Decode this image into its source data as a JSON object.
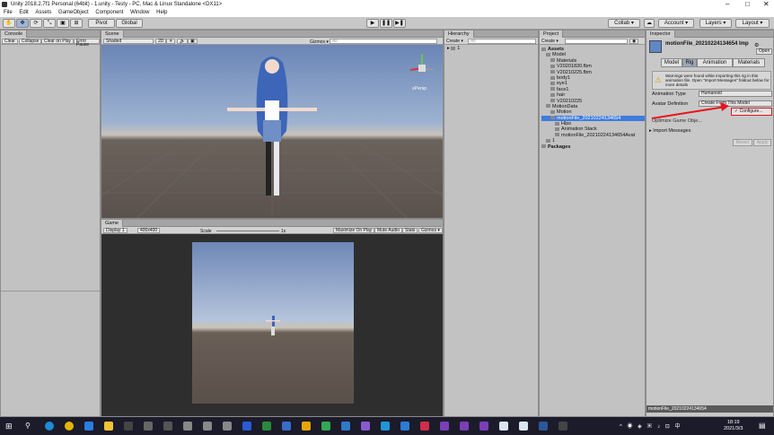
{
  "window": {
    "title": "Unity 2018.2.7f1 Personal (64bit) - 1.unity - Testy - PC, Mac & Linux Standalone <DX11>"
  },
  "menu": [
    "File",
    "Edit",
    "Assets",
    "GameObject",
    "Component",
    "Window",
    "Help"
  ],
  "toolbar": {
    "pivot": "Pivot",
    "global": "Global",
    "collab": "Collab ▾",
    "account": "Account ▾",
    "layers": "Layers ▾",
    "layout": "Layout ▾"
  },
  "console": {
    "tab": "Console",
    "buttons": [
      "Clear",
      "Collapse",
      "Clear on Play",
      "Error Pause"
    ]
  },
  "scene": {
    "tab": "Scene",
    "shading": "Shaded",
    "mode2d": "2D",
    "gizmos": "Gizmos ▾",
    "search_placeholder": "All",
    "persp": "≡Persp"
  },
  "game": {
    "tab": "Game",
    "display": "Display 1",
    "resolution": "400x400",
    "scale_label": "Scale",
    "scale_value": "1x",
    "buttons": [
      "Maximize On Play",
      "Mute Audio",
      "Stats",
      "Gizmos ▾"
    ]
  },
  "hierarchy": {
    "tab": "Hierarchy",
    "create": "Create ▾",
    "search_placeholder": "All",
    "root": "1"
  },
  "project": {
    "tab": "Project",
    "create": "Create ▾",
    "items": [
      {
        "label": "Assets",
        "bold": true,
        "depth": 0
      },
      {
        "label": "Model",
        "depth": 1
      },
      {
        "label": "Materials",
        "depth": 2
      },
      {
        "label": "V20201830.fbm",
        "depth": 2
      },
      {
        "label": "V20210225.fbm",
        "depth": 2
      },
      {
        "label": "body1",
        "depth": 2
      },
      {
        "label": "eye1",
        "depth": 2
      },
      {
        "label": "face1",
        "depth": 2
      },
      {
        "label": "hair",
        "depth": 2
      },
      {
        "label": "V20210225",
        "depth": 2
      },
      {
        "label": "MotionData",
        "depth": 1
      },
      {
        "label": "Motion",
        "depth": 2
      },
      {
        "label": "motionFile_20210224134654",
        "depth": 2,
        "selected": true
      },
      {
        "label": "Hips",
        "depth": 3
      },
      {
        "label": "Animation Stack",
        "depth": 3
      },
      {
        "label": "motionFile_20210224134654Avat",
        "depth": 3
      },
      {
        "label": "1",
        "depth": 1
      },
      {
        "label": "Packages",
        "bold": true,
        "depth": 0
      }
    ]
  },
  "inspector": {
    "tab": "Inspector",
    "object_name": "motionFile_20210224134654 Imp",
    "open": "Open",
    "tabs": [
      "Model",
      "Rig",
      "Animation",
      "Materials"
    ],
    "active_tab": "Rig",
    "warning": "Warnings were found while importing this rig in this animation file. Open \"Import Messages\" foldout below for more details",
    "animation_type_label": "Animation Type",
    "animation_type_value": "Humanoid",
    "avatar_def_label": "Avatar Definition",
    "avatar_def_value": "Create From This Model",
    "configure": "✓ Configure...",
    "optimize": "Optimize Game Obje...",
    "import_messages": "Import Messages",
    "revert": "Revert",
    "apply": "Apply",
    "footer": "motionFile_20210224134654"
  },
  "taskbar": {
    "time": "18:19",
    "date": "2021/3/3",
    "ime": "中"
  },
  "colors": {
    "annotation": "#e8141c",
    "selection": "#3e7ce0",
    "sky_top": "#6d87b5",
    "ground": "#5a4f4a"
  }
}
